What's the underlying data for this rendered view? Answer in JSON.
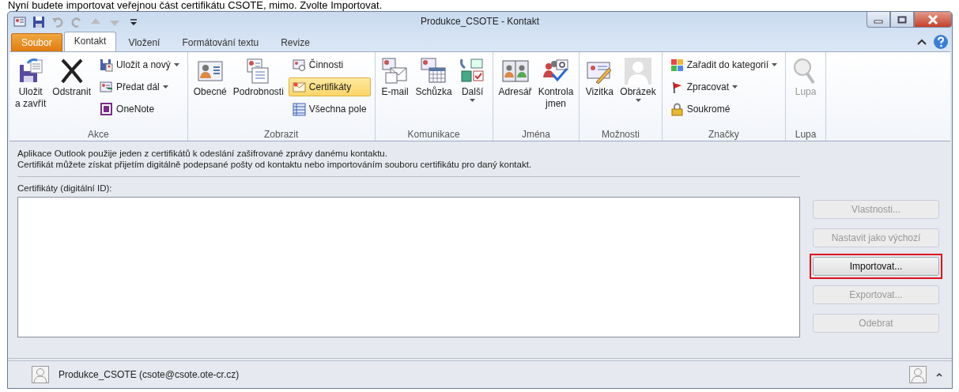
{
  "caption": "Nyní budete importovat veřejnou část certifikátu CSOTE, mimo. Zvolte Importovat.",
  "window": {
    "title": "Produkce_CSOTE - Kontakt"
  },
  "tabs": [
    {
      "label": "Soubor",
      "kind": "file",
      "selected": false
    },
    {
      "label": "Kontakt",
      "kind": "tab",
      "selected": true
    },
    {
      "label": "Vložení",
      "kind": "tab",
      "selected": false
    },
    {
      "label": "Formátování textu",
      "kind": "tab",
      "selected": false
    },
    {
      "label": "Revize",
      "kind": "tab",
      "selected": false
    }
  ],
  "ribbon_groups": [
    {
      "label": "Akce",
      "items": [
        {
          "kind": "large",
          "label": "Uložit\na zavřít"
        },
        {
          "kind": "large",
          "label": "Odstranit"
        },
        {
          "kind": "column",
          "items": [
            {
              "label": "Uložit a nový",
              "dropdown": true,
              "selected": false
            },
            {
              "label": "Předat dál",
              "dropdown": true,
              "selected": false
            },
            {
              "label": "OneNote",
              "dropdown": false,
              "selected": false
            }
          ]
        }
      ]
    },
    {
      "label": "Zobrazit",
      "items": [
        {
          "kind": "large",
          "label": "Obecné"
        },
        {
          "kind": "large",
          "label": "Podrobnosti"
        },
        {
          "kind": "column",
          "items": [
            {
              "label": "Činnosti",
              "dropdown": false,
              "selected": false
            },
            {
              "label": "Certifikáty",
              "dropdown": false,
              "selected": true
            },
            {
              "label": "Všechna pole",
              "dropdown": false,
              "selected": false
            }
          ]
        }
      ]
    },
    {
      "label": "Komunikace",
      "items": [
        {
          "kind": "large",
          "label": "E-mail"
        },
        {
          "kind": "large",
          "label": "Schůzka"
        },
        {
          "kind": "large",
          "label": "Další",
          "dropdown": true
        }
      ]
    },
    {
      "label": "Jména",
      "items": [
        {
          "kind": "large",
          "label": "Adresář"
        },
        {
          "kind": "large",
          "label": "Kontrola\njmen"
        }
      ]
    },
    {
      "label": "Možnosti",
      "items": [
        {
          "kind": "large",
          "label": "Vizitka"
        },
        {
          "kind": "large",
          "label": "Obrázek",
          "dropdown": true
        }
      ]
    },
    {
      "label": "Značky",
      "items": [
        {
          "kind": "column",
          "items": [
            {
              "label": "Zařadit do kategorií",
              "dropdown": true,
              "selected": false
            },
            {
              "label": "Zpracovat",
              "dropdown": true,
              "selected": false
            },
            {
              "label": "Soukromé",
              "dropdown": false,
              "selected": false
            }
          ]
        }
      ]
    },
    {
      "label": "Lupa",
      "items": [
        {
          "kind": "large",
          "label": "Lupa",
          "disabled": true
        }
      ]
    }
  ],
  "info": [
    "Aplikace Outlook použije jeden z certifikátů k odeslání zašifrované zprávy danému kontaktu.",
    "Certifikát můžete získat přijetím digitálně podepsané pošty od kontaktu nebo importováním souboru certifikátu pro daný kontakt."
  ],
  "certificates_label": "Certifikáty (digitální ID):",
  "buttons": [
    {
      "label": "Vlastnosti...",
      "disabled": true,
      "highlighted": false
    },
    {
      "label": "Nastavit jako výchozí",
      "disabled": true,
      "highlighted": false
    },
    {
      "label": "Importovat...",
      "disabled": false,
      "highlighted": true
    },
    {
      "label": "Exportovat...",
      "disabled": true,
      "highlighted": false
    },
    {
      "label": "Odebrat",
      "disabled": true,
      "highlighted": false
    }
  ],
  "people_pane": {
    "contact": "Produkce_CSOTE (csote@csote.ote-cr.cz)"
  }
}
